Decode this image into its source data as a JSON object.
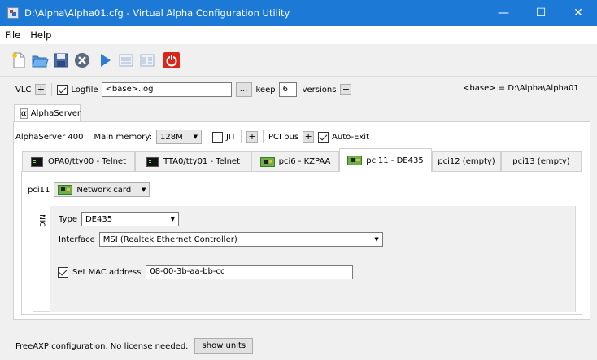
{
  "window": {
    "title": "D:\\Alpha\\Alpha01.cfg - Virtual Alpha Configuration Utility",
    "minimize": "—",
    "maximize": "☐",
    "close": "✕"
  },
  "menu": {
    "file": "File",
    "help": "Help"
  },
  "toolbar": {
    "icons": [
      "new-file-icon",
      "open-folder-icon",
      "save-disk-icon",
      "close-circle-icon",
      "run-play-icon",
      "list-view-icon",
      "detail-view-icon",
      "power-off-icon"
    ],
    "power_color": "#d9261c",
    "accent": "#1c7ad6"
  },
  "vlc_row": {
    "vlc_label": "VLC",
    "plus": "+",
    "logfile_label": "Logfile",
    "logfile_value": "<base>.log",
    "browse": "...",
    "keep_label": "keep",
    "keep_value": "6",
    "versions_label": "versions",
    "base_path": "<base> = D:\\Alpha\\Alpha01"
  },
  "server_tab": {
    "label": "AlphaServer"
  },
  "server_row": {
    "model": "AlphaServer 400",
    "memory_label": "Main memory:",
    "memory_value": "128M",
    "jit_label": "JIT",
    "plus": "+",
    "pci_label": "PCI bus",
    "autoexit_label": "Auto-Exit"
  },
  "tabs": [
    {
      "label": "OPA0/tty00 - Telnet"
    },
    {
      "label": "TTA0/tty01 - Telnet"
    },
    {
      "label": "pci6 - KZPAA"
    },
    {
      "label": "pci11 - DE435"
    },
    {
      "label": "pci12 (empty)"
    },
    {
      "label": "pci13 (empty)"
    }
  ],
  "pci11": {
    "slot_label": "pci11",
    "device_value": "Network card",
    "subtab_label": "NIC",
    "type_label": "Type",
    "type_value": "DE435",
    "interface_label": "Interface",
    "interface_value": "MSI (Realtek Ethernet Controller)",
    "mac_label": "Set MAC address",
    "mac_value": "08-00-3b-aa-bb-cc"
  },
  "status": {
    "text": "FreeAXP configuration. No license needed.",
    "show_units": "show units"
  }
}
